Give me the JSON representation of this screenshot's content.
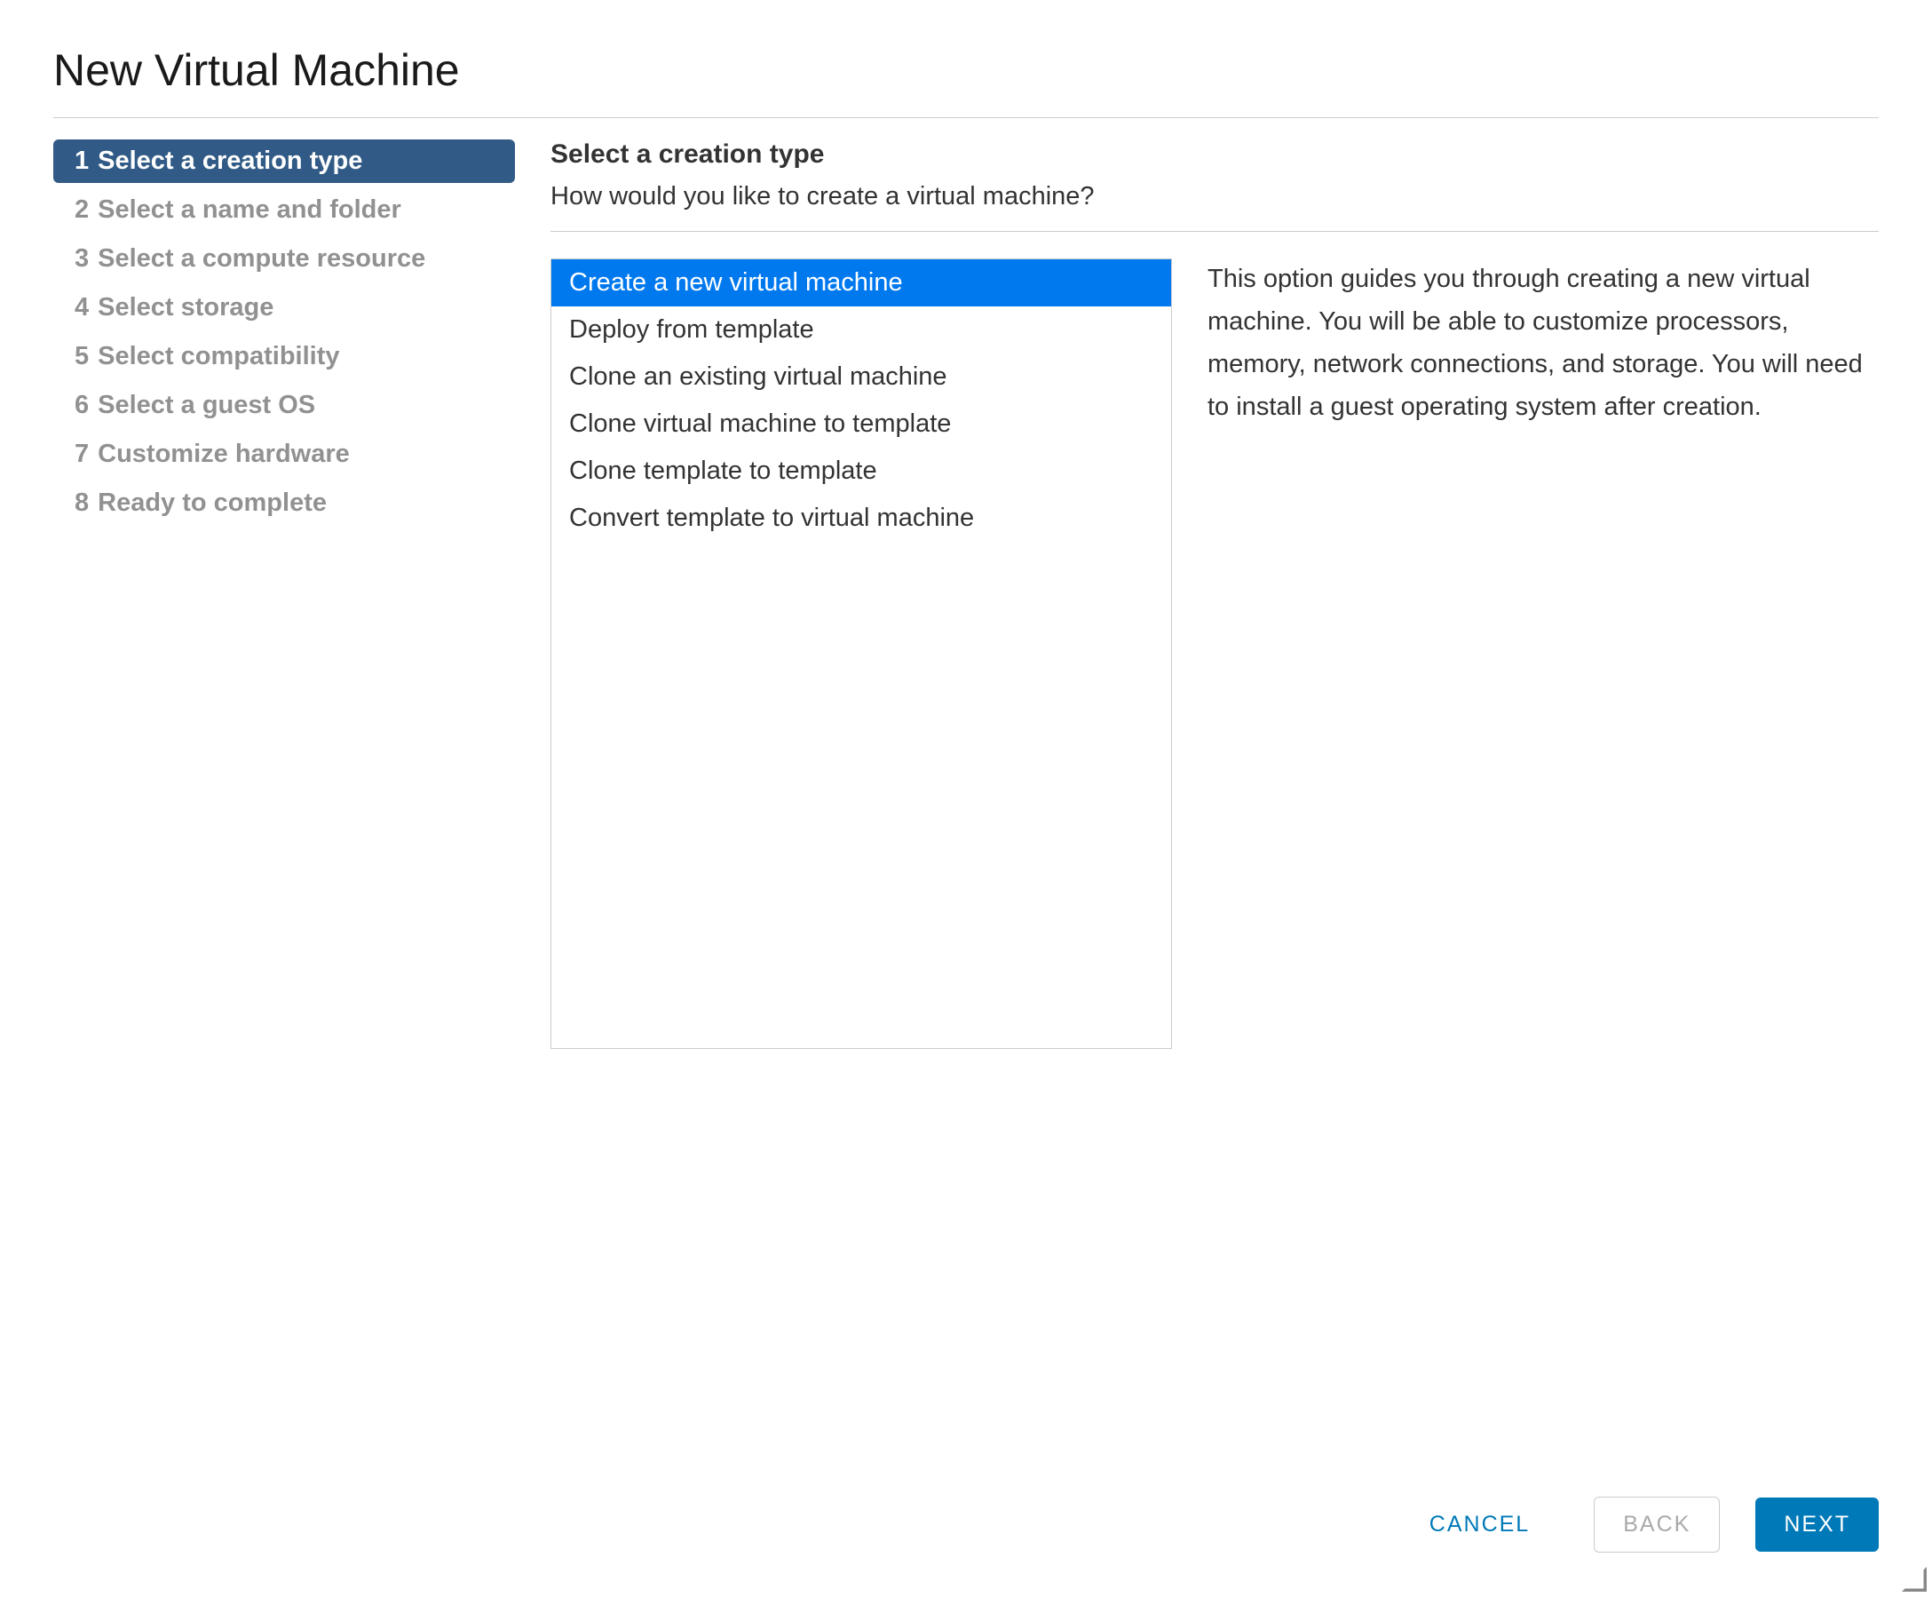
{
  "dialog": {
    "title": "New Virtual Machine"
  },
  "sidebar": {
    "steps": [
      {
        "num": "1",
        "label": "Select a creation type",
        "active": true
      },
      {
        "num": "2",
        "label": "Select a name and folder",
        "active": false
      },
      {
        "num": "3",
        "label": "Select a compute resource",
        "active": false
      },
      {
        "num": "4",
        "label": "Select storage",
        "active": false
      },
      {
        "num": "5",
        "label": "Select compatibility",
        "active": false
      },
      {
        "num": "6",
        "label": "Select a guest OS",
        "active": false
      },
      {
        "num": "7",
        "label": "Customize hardware",
        "active": false
      },
      {
        "num": "8",
        "label": "Ready to complete",
        "active": false
      }
    ]
  },
  "main": {
    "section_title": "Select a creation type",
    "section_subtitle": "How would you like to create a virtual machine?",
    "options": [
      {
        "label": "Create a new virtual machine",
        "selected": true
      },
      {
        "label": "Deploy from template",
        "selected": false
      },
      {
        "label": "Clone an existing virtual machine",
        "selected": false
      },
      {
        "label": "Clone virtual machine to template",
        "selected": false
      },
      {
        "label": "Clone template to template",
        "selected": false
      },
      {
        "label": "Convert template to virtual machine",
        "selected": false
      }
    ],
    "description": "This option guides you through creating a new virtual machine. You will be able to customize processors, memory, network connections, and storage. You will need to install a guest operating system after creation."
  },
  "footer": {
    "cancel": "CANCEL",
    "back": "BACK",
    "next": "NEXT"
  }
}
